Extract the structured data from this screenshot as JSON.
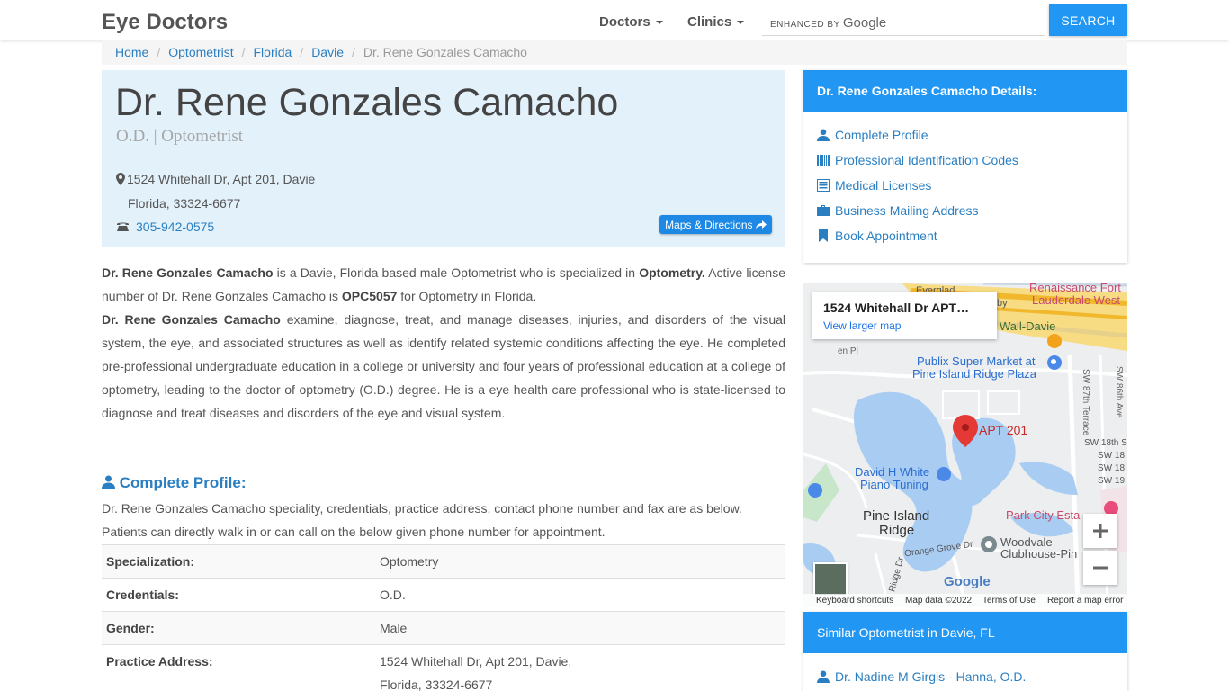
{
  "brand": "Eye Doctors",
  "nav": {
    "doctors": "Doctors",
    "clinics": "Clinics"
  },
  "search": {
    "enhanced": "ENHANCED BY",
    "google": "Google",
    "button": "SEARCH"
  },
  "breadcrumb": [
    "Home",
    "Optometrist",
    "Florida",
    "Davie",
    "Dr. Rene Gonzales Camacho"
  ],
  "hero": {
    "name": "Dr. Rene Gonzales Camacho",
    "subtitle": "O.D. | Optometrist",
    "address_line1": "1524 Whitehall Dr, Apt 201, Davie",
    "address_line2": "Florida, 33324-6677",
    "phone": "305-942-0575",
    "maps_button": "Maps & Directions"
  },
  "description": {
    "p1_name": "Dr. Rene Gonzales Camacho",
    "p1_a": " is a Davie, Florida based male Optometrist who is specialized in ",
    "p1_spec": "Optometry.",
    "p1_b": " Active license number of Dr. Rene Gonzales Camacho is ",
    "p1_license": "OPC5057",
    "p1_c": " for Optometry in Florida.",
    "p2_name": "Dr. Rene Gonzales Camacho",
    "p2_text": " examine, diagnose, treat, and manage diseases, injuries, and disorders of the visual system, the eye, and associated structures as well as identify related systemic conditions affecting the eye. He completed pre-professional undergraduate education in a college or university and four years of professional education at a college of optometry, leading to the doctor of optometry (O.D.) degree. He is a eye health care professional who is state-licensed to diagnose and treat diseases and disorders of the eye and visual system."
  },
  "profile": {
    "title": "Complete Profile:",
    "text": "Dr. Rene Gonzales Camacho speciality, credentials, practice address, contact phone number and fax are as below. Patients can directly walk in or can call on the below given phone number for appointment.",
    "rows": [
      {
        "k": "Specialization:",
        "v": "Optometry"
      },
      {
        "k": "Credentials:",
        "v": "O.D."
      },
      {
        "k": "Gender:",
        "v": "Male"
      },
      {
        "k": "Practice Address:",
        "v": "1524 Whitehall Dr, Apt 201, Davie,",
        "v2": "Florida, 33324-6677"
      }
    ]
  },
  "details_panel": {
    "title": "Dr. Rene Gonzales Camacho Details:",
    "links": [
      "Complete Profile",
      "Professional Identification Codes",
      "Medical Licenses",
      "Business Mailing Address",
      "Book Appointment"
    ]
  },
  "map": {
    "card_title": "1524 Whitehall Dr APT…",
    "card_link": "View larger map",
    "labels": {
      "renaissance1": "Renaissance Fort",
      "renaissance2": "Lauderdale West",
      "everglades": "Everglad",
      "wall_davie": "Wall-Davie",
      "publix1": "Publix Super Market at",
      "publix2": "Pine Island Ridge Plaza",
      "apt": "APT 201",
      "david1": "David H White",
      "david2": "Piano Tuning",
      "pine1": "Pine Island",
      "pine2": "Ridge",
      "park": "Park City Esta",
      "woodvale1": "Woodvale",
      "woodvale2": "Clubhouse-Pin",
      "orange": "Orange Grove Dr",
      "sw87": "SW 87th Terrace",
      "sw86": "SW 86th Ave",
      "sw18": "SW 18th S",
      "sw18b": "SW 18",
      "sw18c": "SW 18",
      "sw19": "SW 19",
      "ridge_dr": "Ridge Dr",
      "en_pl": "en Pl",
      "by": "by",
      "google": "Google"
    },
    "attrib": {
      "shortcuts": "Keyboard shortcuts",
      "data": "Map data ©2022",
      "terms": "Terms of Use",
      "report": "Report a map error"
    }
  },
  "similar_panel": {
    "title": "Similar Optometrist in Davie, FL",
    "links": [
      "Dr. Nadine M Girgis - Hanna, O.D."
    ]
  },
  "colors": {
    "primary": "#2196f3",
    "link": "#2a7fc2",
    "hero_bg": "#e3f1fb"
  }
}
